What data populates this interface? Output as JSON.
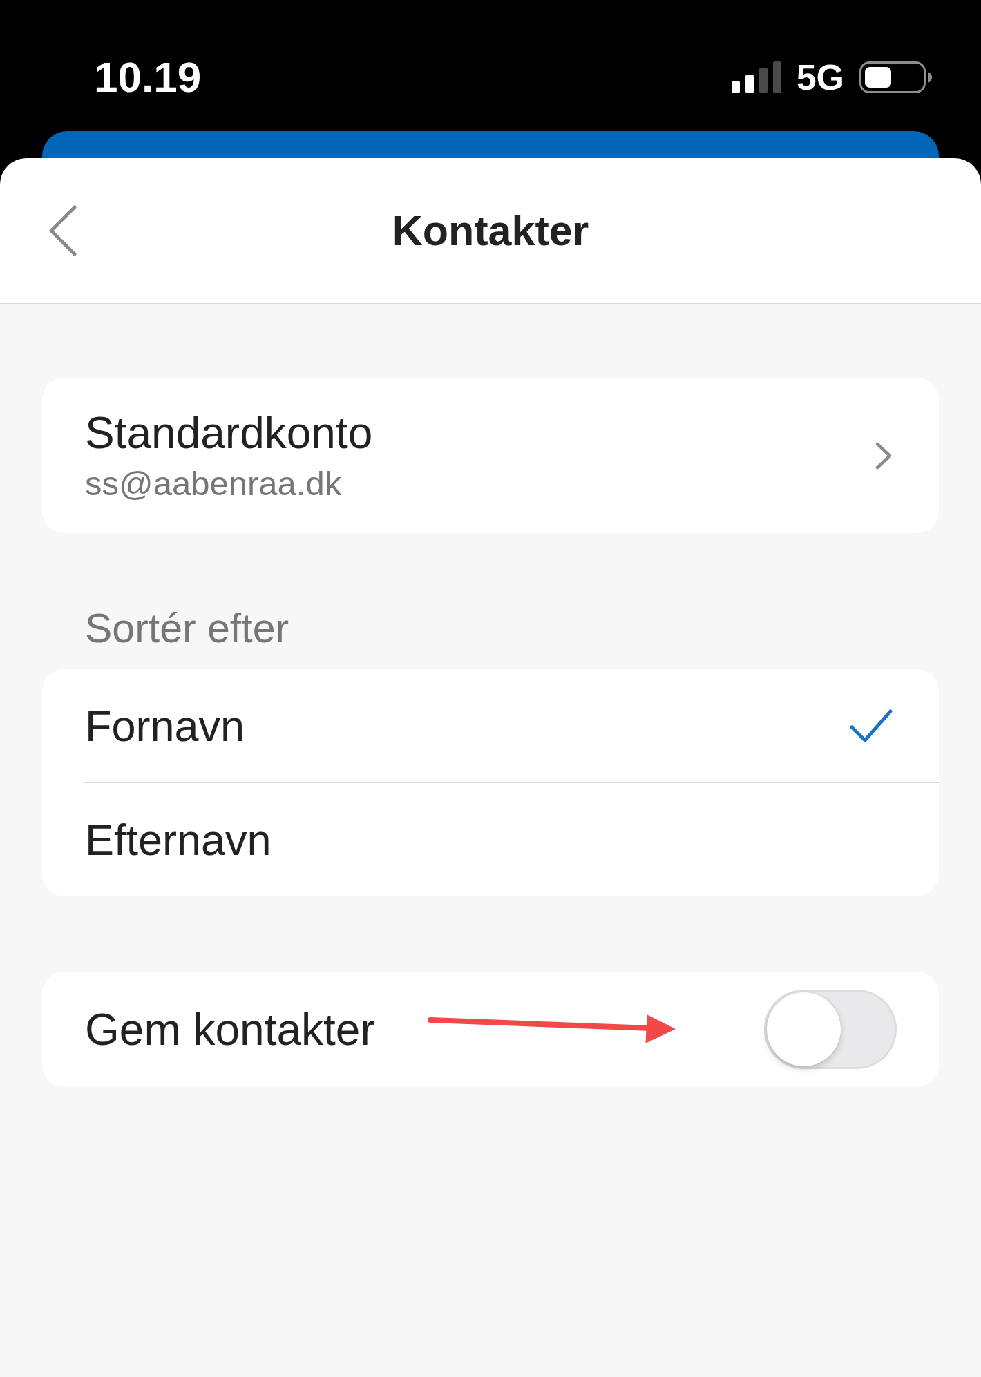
{
  "status_bar": {
    "time": "10.19",
    "network": "5G"
  },
  "header": {
    "title": "Kontakter"
  },
  "account": {
    "label": "Standardkonto",
    "value": "ss@aabenraa.dk"
  },
  "sort": {
    "heading": "Sortér efter",
    "options": [
      {
        "label": "Fornavn",
        "selected": true
      },
      {
        "label": "Efternavn",
        "selected": false
      }
    ]
  },
  "save_contacts": {
    "label": "Gem kontakter",
    "on": false,
    "annotation": {
      "kind": "arrow"
    }
  }
}
